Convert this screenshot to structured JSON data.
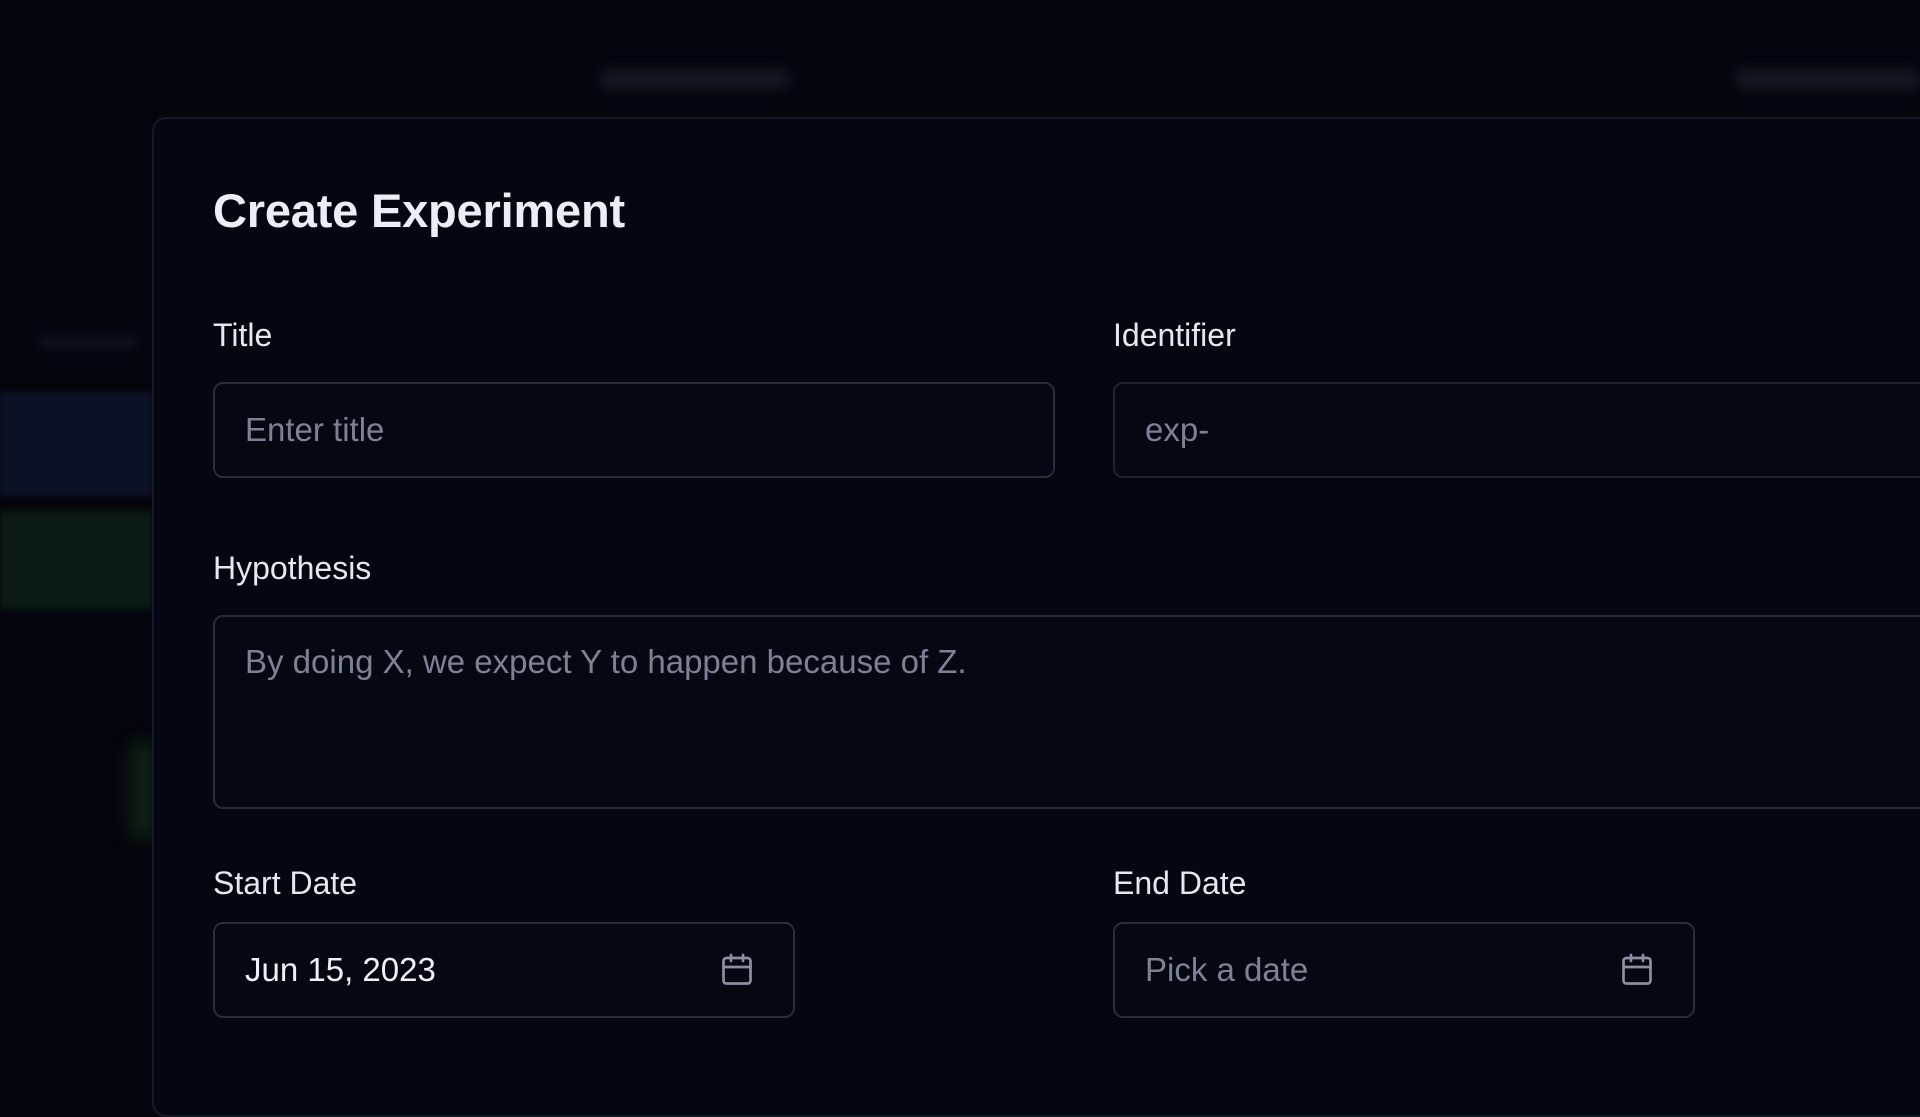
{
  "modal": {
    "title": "Create Experiment"
  },
  "fields": {
    "title": {
      "label": "Title",
      "placeholder": "Enter title"
    },
    "identifier": {
      "label": "Identifier",
      "placeholder": "exp-"
    },
    "hypothesis": {
      "label": "Hypothesis",
      "placeholder": "By doing X, we expect Y to happen because of Z."
    },
    "start_date": {
      "label": "Start Date",
      "value": "Jun 15, 2023",
      "icon": "calendar-icon"
    },
    "end_date": {
      "label": "End Date",
      "placeholder": "Pick a date",
      "icon": "calendar-icon"
    }
  },
  "colors": {
    "background": "#04050d",
    "modal_background": "#040611",
    "border": "#272d3b",
    "text": "#eceef5",
    "placeholder": "#7c8294"
  }
}
